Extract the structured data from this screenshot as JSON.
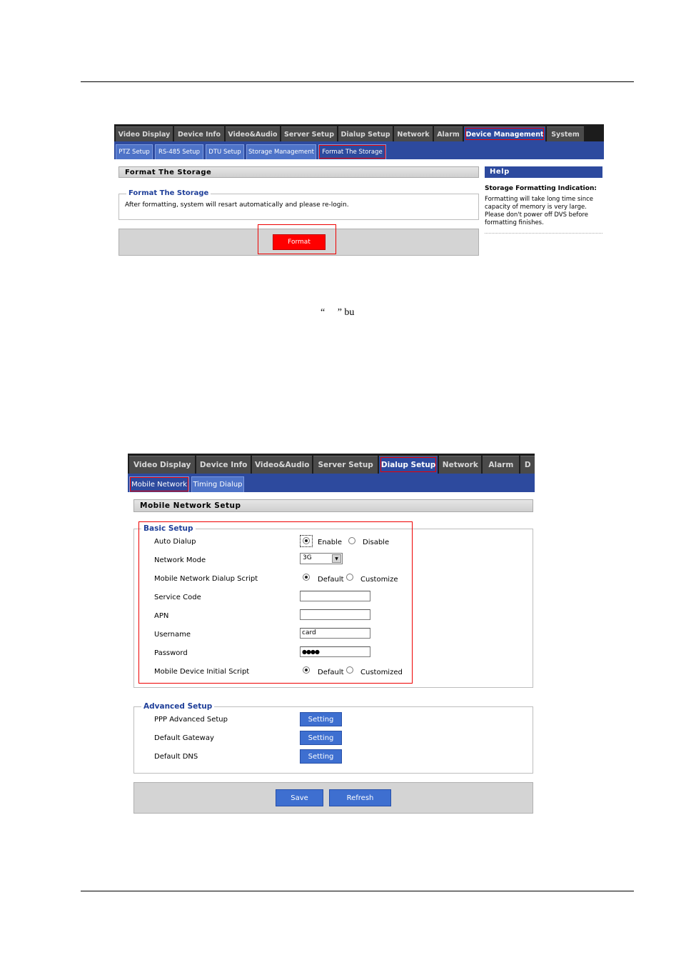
{
  "doc": {
    "fragment": "“     ” bu"
  },
  "format_screen": {
    "top_tabs": [
      {
        "label": "Video Display",
        "w": 80
      },
      {
        "label": "Device Info",
        "w": 70
      },
      {
        "label": "Video&Audio",
        "w": 76
      },
      {
        "label": "Server Setup",
        "w": 78
      },
      {
        "label": "Dialup Setup",
        "w": 76
      },
      {
        "label": "Network",
        "w": 54
      },
      {
        "label": "Alarm",
        "w": 40
      },
      {
        "label": "Device Management",
        "w": 114
      },
      {
        "label": "System",
        "w": 52
      }
    ],
    "sub_tabs": [
      "PTZ Setup",
      "RS-485 Setup",
      "DTU Setup",
      "Storage Management",
      "Format The Storage"
    ],
    "section_title": "Format The Storage",
    "fieldset_legend": "Format The Storage",
    "message": "After formatting, system will resart automatically and please re-login.",
    "format_button": "Format",
    "help_title": "Help",
    "help_heading": "Storage Formatting Indication:",
    "help_text": "Formatting will take long time since capacity of memory is very large. Please don't power off DVS before formatting finishes.",
    "colors": {
      "accent": "#2d4a9e",
      "format_button": "#ff0000"
    }
  },
  "dialup_screen": {
    "top_tabs": [
      {
        "label": "Video Display",
        "w": 94
      },
      {
        "label": "Device Info",
        "w": 77
      },
      {
        "label": "Video&Audio",
        "w": 86
      },
      {
        "label": "Server Setup",
        "w": 91
      },
      {
        "label": "Dialup Setup",
        "w": 84
      },
      {
        "label": "Network",
        "w": 60
      },
      {
        "label": "Alarm",
        "w": 52
      },
      {
        "label": "D",
        "w": 20
      }
    ],
    "sub_tabs": [
      "Mobile Network",
      "Timing Dialup"
    ],
    "section_title": "Mobile Network Setup",
    "basic": {
      "legend": "Basic Setup",
      "auto_dialup": "Auto Dialup",
      "enable": "Enable",
      "disable": "Disable",
      "network_mode": "Network Mode",
      "network_mode_value": "3G",
      "dialup_script": "Mobile Network Dialup Script",
      "default": "Default",
      "customize": "Customize",
      "service_code": "Service Code",
      "apn": "APN",
      "username": "Username",
      "username_value": "card",
      "password": "Password",
      "password_value": "●●●●",
      "init_script": "Mobile Device Initial Script",
      "customized": "Customized"
    },
    "advanced": {
      "legend": "Advanced Setup",
      "ppp": "PPP Advanced Setup",
      "gateway": "Default Gateway",
      "dns": "Default DNS",
      "setting": "Setting"
    },
    "save": "Save",
    "refresh": "Refresh"
  }
}
